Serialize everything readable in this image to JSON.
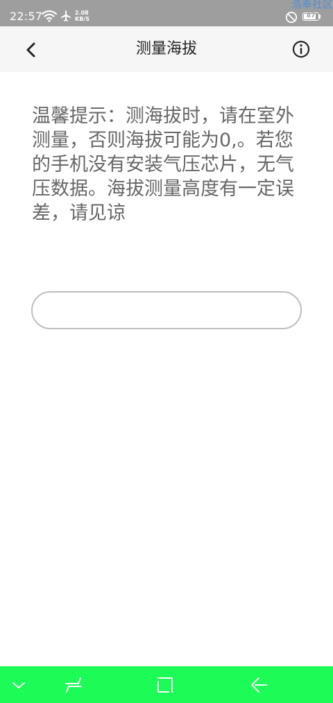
{
  "status_bar": {
    "time": "22:57",
    "net_speed_value": "2.08",
    "net_speed_unit": "KB/S",
    "watermark": "浩奉社区",
    "battery_level": "87",
    "battery_percent": 0.87,
    "icons": [
      "wifi-icon",
      "airplane-icon",
      "do-not-disturb-icon",
      "battery-icon"
    ]
  },
  "header": {
    "title": "测量海拔",
    "back_icon": "chevron-left-icon",
    "info_icon": "info-circle-icon"
  },
  "main": {
    "tip": "温馨提示：测海拔时，请在室外测量，否则海拔可能为0,。若您的手机没有安装气压芯片，无气压数据。海拔测量高度有一定误差，请见谅",
    "altitude_value": ""
  },
  "nav_bar": {
    "buttons": [
      "collapse-icon",
      "recent-apps-icon",
      "home-icon",
      "back-icon"
    ]
  },
  "colors": {
    "status_bar_bg": "#9e9e9e",
    "header_bg": "#f6f6f6",
    "nav_bar_bg": "#1dfb56",
    "tip_text": "#666666",
    "field_border": "#bdbdbd"
  }
}
